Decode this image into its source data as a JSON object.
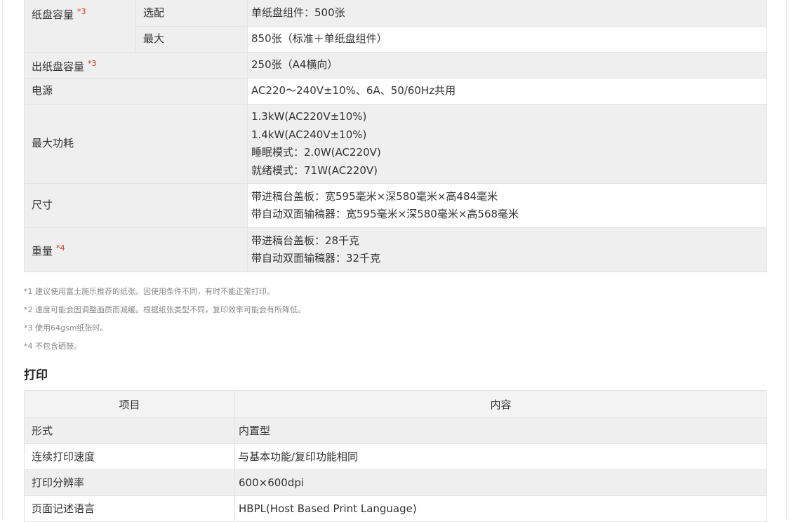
{
  "spec_rows": [
    {
      "label": "纸盘容量",
      "mark": "*3",
      "sub": "选配",
      "value": [
        "单纸盘组件：500张"
      ]
    },
    {
      "sub": "最大",
      "value": [
        "850张（标准＋单纸盘组件）"
      ]
    },
    {
      "label": "出纸盘容量",
      "mark": "*3",
      "value": [
        "250张（A4横向）"
      ]
    },
    {
      "label": "电源",
      "value": [
        "AC220～240V±10%、6A、50/60Hz共用"
      ]
    },
    {
      "label": "最大功耗",
      "value": [
        "1.3kW(AC220V±10%)",
        "1.4kW(AC240V±10%)",
        "睡眠模式：2.0W(AC220V)",
        "就绪模式：71W(AC220V)"
      ]
    },
    {
      "label": "尺寸",
      "value": [
        "带进稿台盖板：宽595毫米×深580毫米×高484毫米",
        "带自动双面输稿器：宽595毫米×深580毫米×高568毫米"
      ]
    },
    {
      "label": "重量",
      "mark": "*4",
      "value": [
        "带进稿台盖板：28千克",
        "带自动双面输稿器：32千克"
      ]
    }
  ],
  "notes": [
    "*1 建议使用富士施乐推荐的纸张。因使用条件不同，有时不能正常打印。",
    "*2 速度可能会因调整画质而减缓。根据纸张类型不同，复印效率可能会有所降低。",
    "*3 使用64gsm纸张时。",
    "*4 不包含硒鼓。"
  ],
  "print_section": {
    "title": "打印",
    "headers": [
      "项目",
      "内容"
    ],
    "rows": [
      {
        "label": "形式",
        "value": "内置型"
      },
      {
        "label": "连续打印速度",
        "value": "与基本功能/复印功能相同"
      },
      {
        "label": "打印分辨率",
        "value": "600×600dpi"
      },
      {
        "label": "页面记述语言",
        "value": "HBPL(Host Based Print Language)"
      }
    ]
  }
}
